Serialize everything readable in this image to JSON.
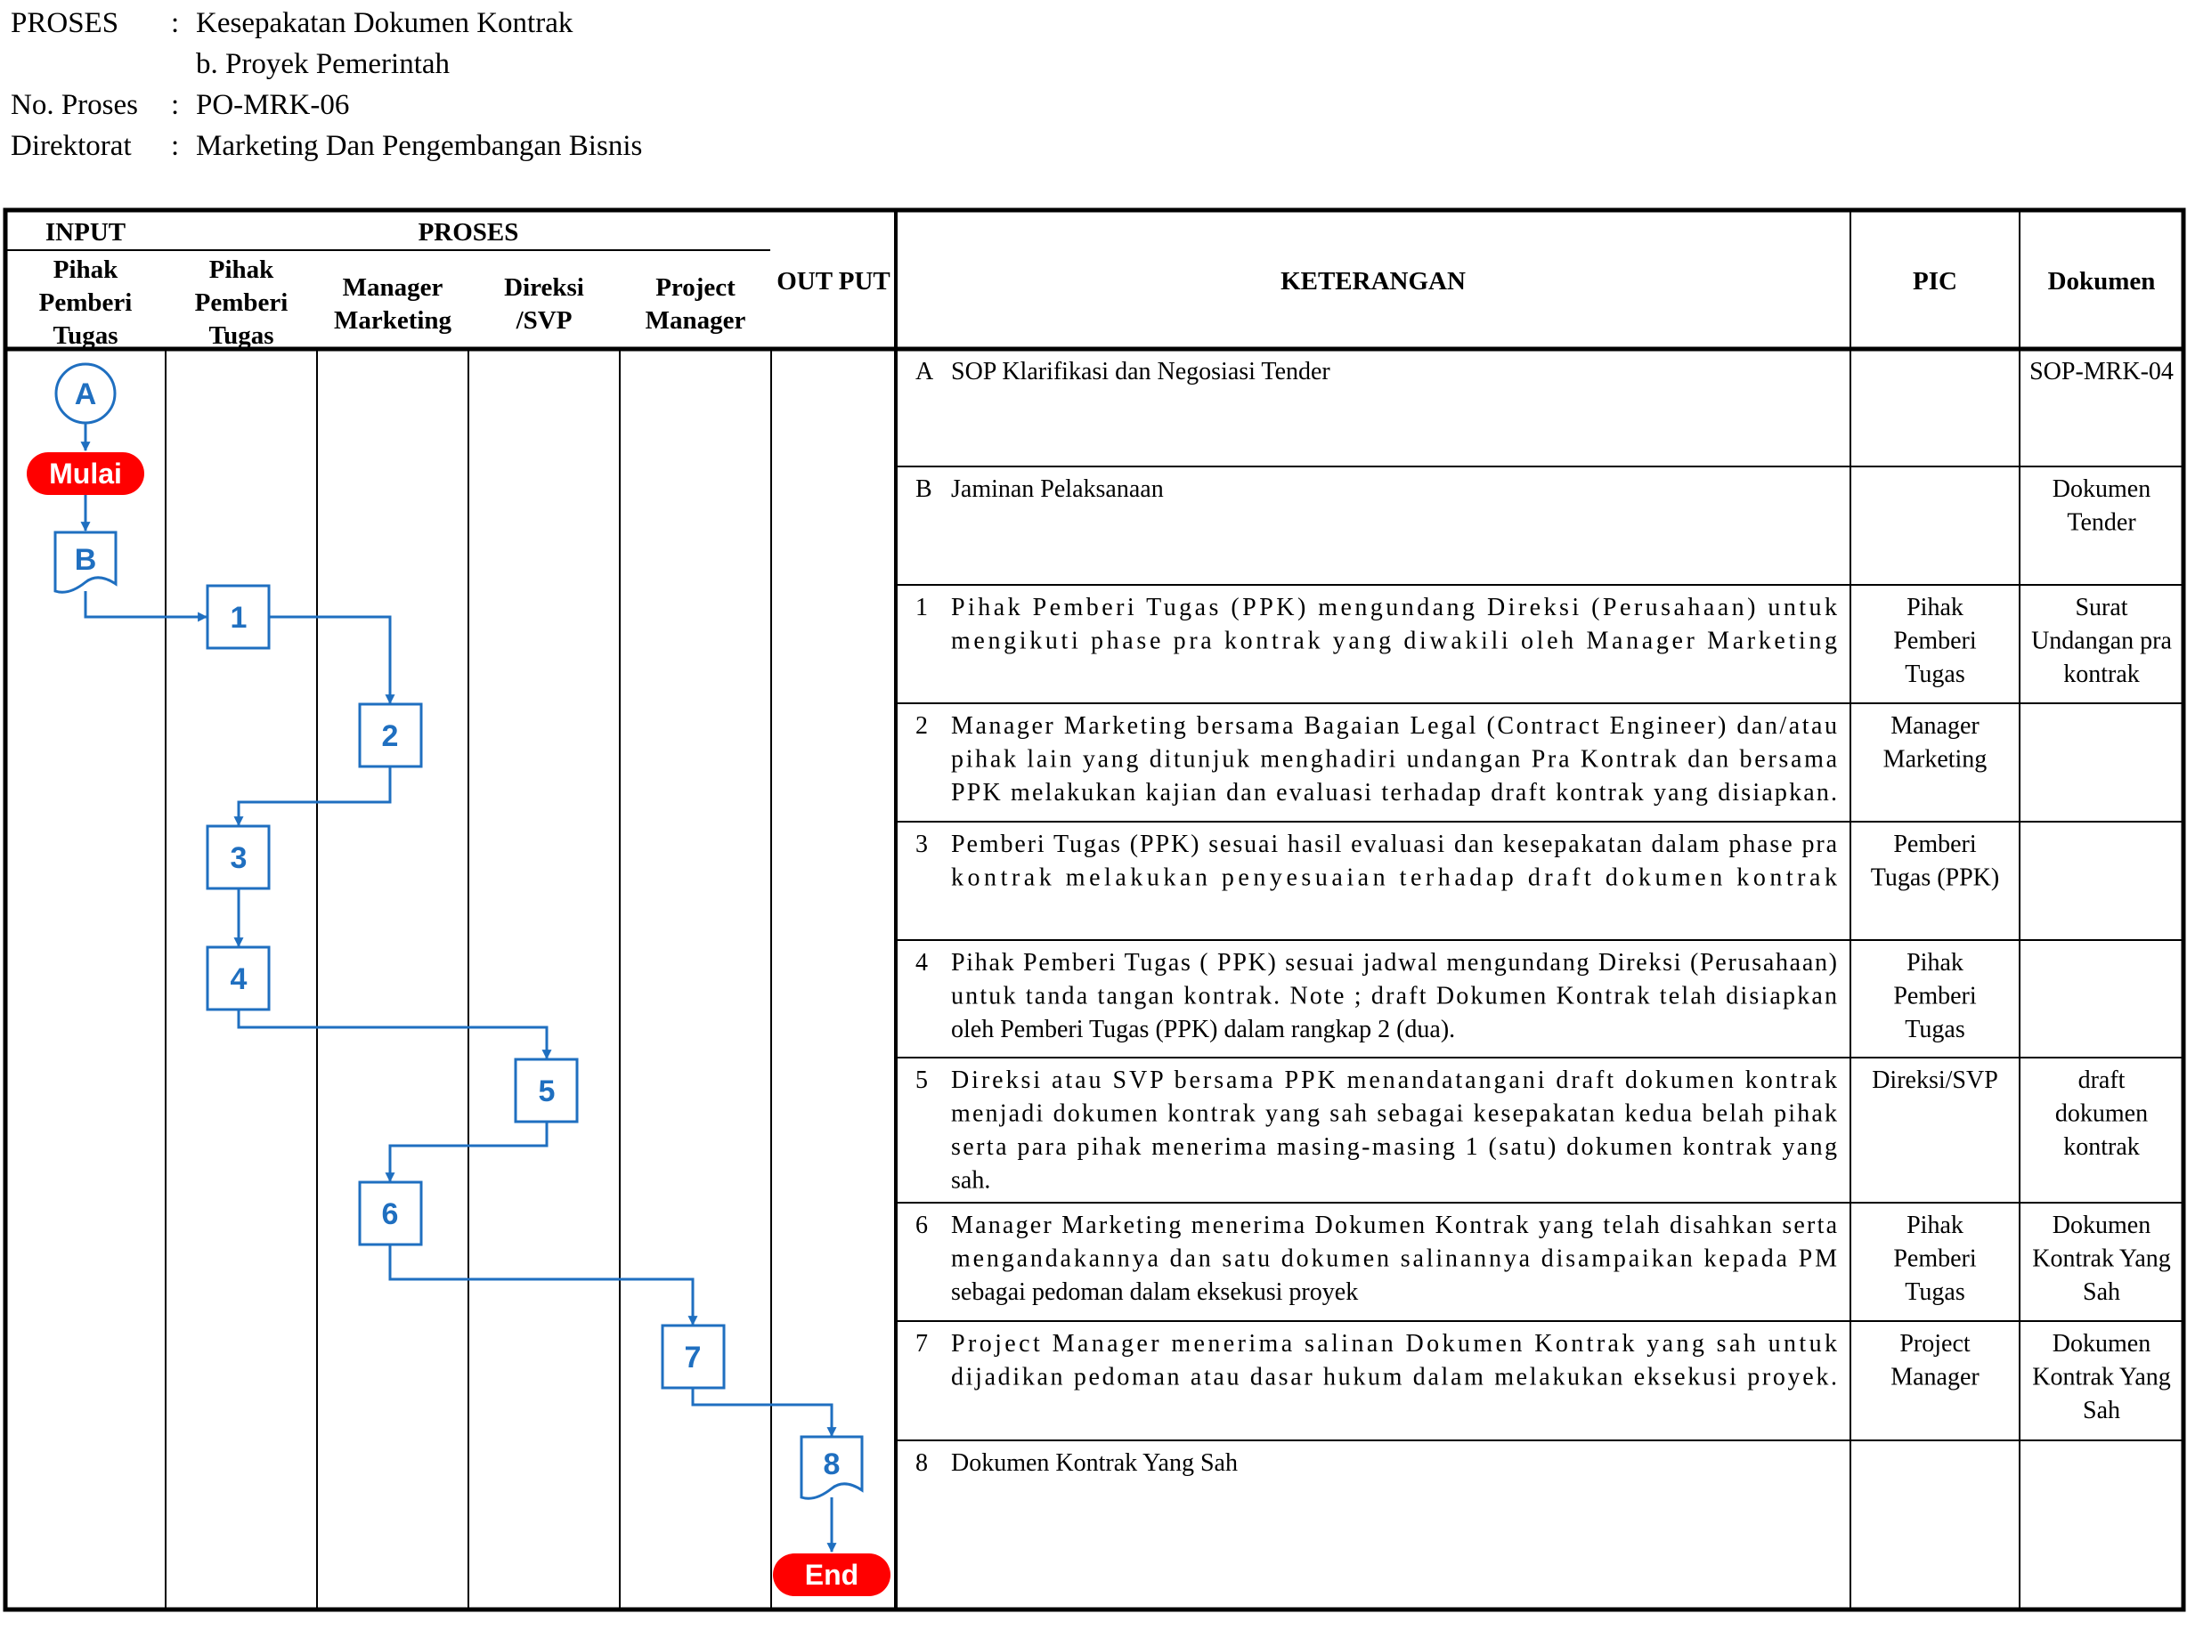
{
  "header": {
    "proses_label": "PROSES",
    "proses_line1": "Kesepakatan Dokumen Kontrak",
    "proses_line2": "b. Proyek Pemerintah",
    "no_label": "No. Proses",
    "no_value": "PO-MRK-06",
    "dir_label": "Direktorat",
    "dir_value": "Marketing Dan Pengembangan Bisnis",
    "colon": ":"
  },
  "table": {
    "input_label": "INPUT",
    "proses_label": "PROSES",
    "output_label": "OUT PUT",
    "keterangan_label": "KETERANGAN",
    "pic_label": "PIC",
    "dokumen_label": "Dokumen",
    "lanes": [
      {
        "lines": [
          "Pihak",
          "Pemberi",
          "Tugas"
        ]
      },
      {
        "lines": [
          "Pihak",
          "Pemberi",
          "Tugas"
        ]
      },
      {
        "lines": [
          "Manager",
          "Marketing"
        ]
      },
      {
        "lines": [
          "Direksi",
          "/SVP"
        ]
      },
      {
        "lines": [
          "Project",
          "Manager"
        ]
      }
    ]
  },
  "rows": [
    {
      "id": "A",
      "text": [
        "SOP Klarifikasi dan Negosiasi Tender"
      ],
      "pic": [],
      "doc": [
        "SOP-MRK-04"
      ]
    },
    {
      "id": "B",
      "text": [
        "Jaminan Pelaksanaan"
      ],
      "pic": [],
      "doc": [
        "Dokumen",
        "Tender"
      ]
    },
    {
      "id": "1",
      "text": [
        "Pihak Pemberi Tugas (PPK) mengundang Direksi (Perusahaan) untuk",
        "mengikuti phase pra kontrak yang diwakili oleh Manager Marketing"
      ],
      "pic": [
        "Pihak",
        "Pemberi",
        "Tugas"
      ],
      "doc": [
        "Surat",
        "Undangan pra",
        "kontrak"
      ]
    },
    {
      "id": "2",
      "text": [
        "Manager Marketing bersama Bagaian Legal (Contract Engineer) dan/atau",
        "pihak lain yang ditunjuk  menghadiri undangan Pra Kontrak dan bersama",
        "PPK melakukan kajian dan evaluasi terhadap draft kontrak yang disiapkan."
      ],
      "pic": [
        "Manager",
        "Marketing"
      ],
      "doc": []
    },
    {
      "id": "3",
      "text": [
        "Pemberi Tugas (PPK) sesuai hasil evaluasi dan kesepakatan dalam phase pra",
        "kontrak melakukan penyesuaian terhadap draft dokumen kontrak"
      ],
      "pic": [
        "Pemberi",
        "Tugas (PPK)"
      ],
      "doc": []
    },
    {
      "id": "4",
      "text": [
        "Pihak Pemberi Tugas ( PPK) sesuai jadwal mengundang Direksi (Perusahaan)",
        "untuk tanda tangan kontrak. Note ; draft Dokumen Kontrak telah disiapkan",
        "oleh Pemberi Tugas (PPK) dalam rangkap 2 (dua)."
      ],
      "pic": [
        "Pihak",
        "Pemberi",
        "Tugas"
      ],
      "doc": []
    },
    {
      "id": "5",
      "text": [
        "Direksi atau SVP bersama PPK menandatangani draft dokumen kontrak",
        "menjadi dokumen kontrak yang sah sebagai kesepakatan kedua belah pihak",
        "serta para pihak menerima masing-masing 1 (satu) dokumen kontrak yang",
        "sah."
      ],
      "pic": [
        "Direksi/SVP"
      ],
      "doc": [
        "draft",
        "dokumen",
        "kontrak"
      ]
    },
    {
      "id": "6",
      "text": [
        "Manager Marketing menerima Dokumen Kontrak yang telah disahkan serta",
        "mengandakannya dan satu dokumen salinannya disampaikan kepada PM",
        "sebagai pedoman dalam eksekusi proyek"
      ],
      "pic": [
        "Pihak",
        "Pemberi",
        "Tugas"
      ],
      "doc": [
        "Dokumen",
        "Kontrak Yang",
        "Sah"
      ]
    },
    {
      "id": "7",
      "text": [
        "Project Manager menerima salinan Dokumen Kontrak yang sah untuk",
        "dijadikan pedoman atau dasar hukum dalam melakukan eksekusi proyek."
      ],
      "pic": [
        "Project",
        "Manager"
      ],
      "doc": [
        "Dokumen",
        "Kontrak Yang",
        "Sah"
      ]
    },
    {
      "id": "8",
      "text": [
        "Dokumen Kontrak Yang Sah"
      ],
      "pic": [],
      "doc": []
    }
  ],
  "flow": {
    "connector": "A",
    "start": "Mulai",
    "doc_in": "B",
    "steps": [
      "1",
      "2",
      "3",
      "4",
      "5",
      "6",
      "7"
    ],
    "doc_out": "8",
    "end": "End"
  },
  "colors": {
    "flow_blue": "#1f6fc0",
    "terminal_red": "#ff0000",
    "line": "#000000"
  }
}
